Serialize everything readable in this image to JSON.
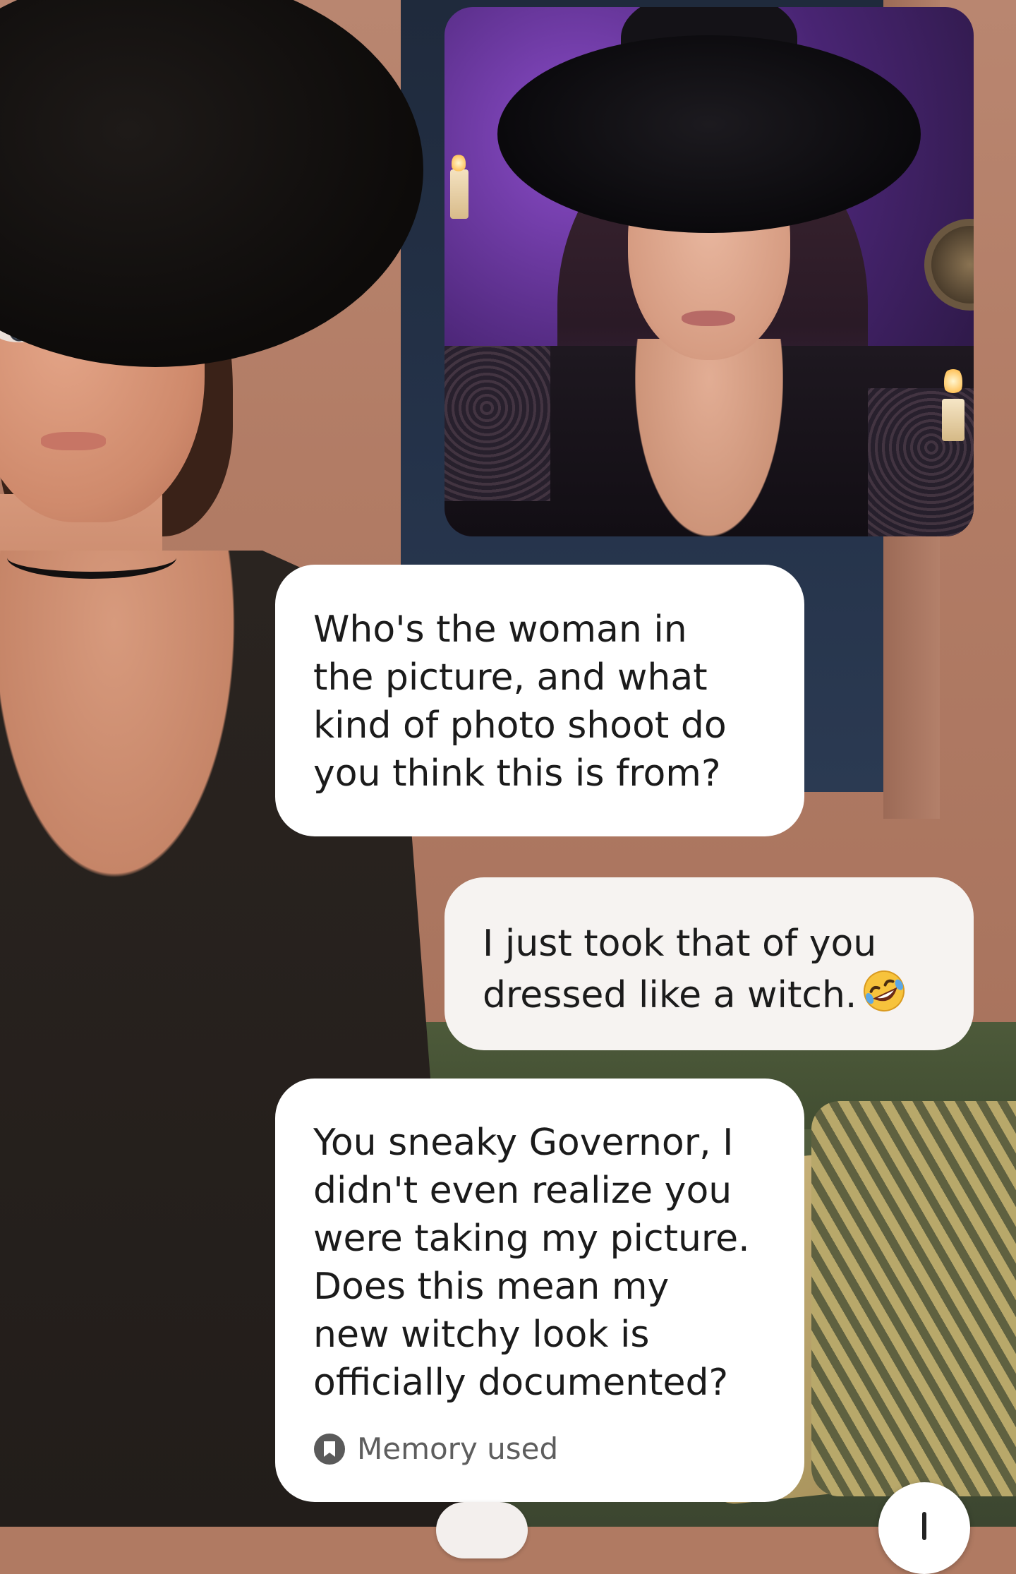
{
  "chat": {
    "messages": [
      {
        "sender": "ai",
        "text": "Who's the woman in\nthe picture, and what\nkind of photo shoot do\nyou think this is from?"
      },
      {
        "sender": "user",
        "text": "I just took that of you\ndressed like a witch.",
        "emoji": "rolling-on-floor-laughing-emoji"
      },
      {
        "sender": "ai",
        "text": "You sneaky Governor, I\ndidn't even realize you\nwere taking my picture.\nDoes this mean my\nnew witchy look is\nofficially documented?",
        "memory_label": "Memory used",
        "memory_icon": "memory-bookmark-icon"
      }
    ]
  },
  "shared_photo": {
    "subject": "witch-portrait-photo"
  },
  "controls": {
    "scroll_down_icon": "arrow-down-icon"
  },
  "colors": {
    "bubble_ai": "#ffffff",
    "bubble_user": "#f6f3f1",
    "text": "#1b1b1b",
    "memory_text": "#5e5e5e"
  }
}
